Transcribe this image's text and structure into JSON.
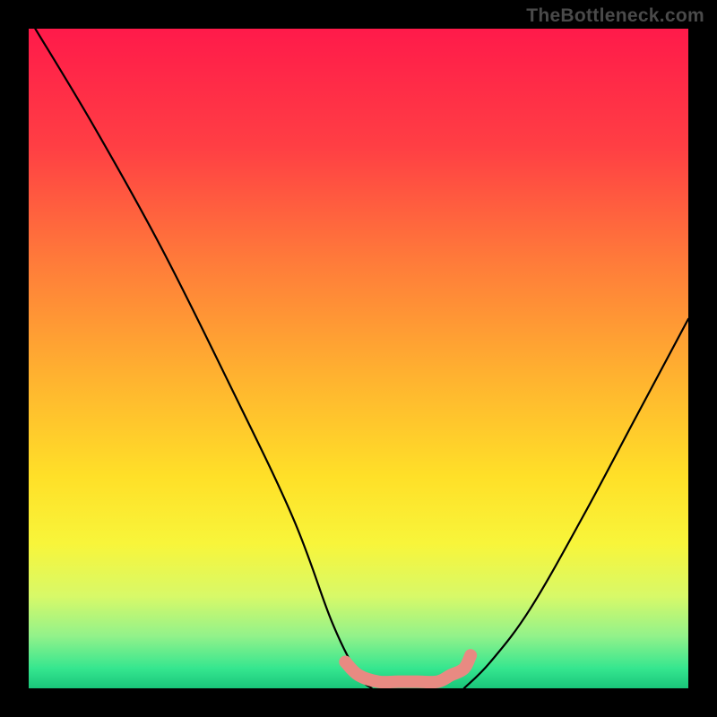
{
  "watermark": "TheBottleneck.com",
  "chart_data": {
    "type": "line",
    "title": "",
    "xlabel": "",
    "ylabel": "",
    "xlim": [
      0,
      100
    ],
    "ylim": [
      0,
      100
    ],
    "series": [
      {
        "name": "left-curve",
        "x": [
          1,
          10,
          20,
          30,
          40,
          46,
          50,
          52
        ],
        "y": [
          100,
          85,
          67,
          47,
          26,
          10,
          2,
          0
        ]
      },
      {
        "name": "right-curve",
        "x": [
          66,
          70,
          76,
          84,
          92,
          100
        ],
        "y": [
          0,
          4,
          12,
          26,
          41,
          56
        ]
      },
      {
        "name": "valley-pink",
        "x": [
          48,
          50,
          53,
          56,
          59,
          62,
          64,
          66,
          67
        ],
        "y": [
          4,
          2,
          1,
          1,
          1,
          1,
          2,
          3,
          5
        ]
      }
    ],
    "background_gradient": {
      "stops": [
        {
          "offset": 0.0,
          "color": "#ff1a4a"
        },
        {
          "offset": 0.18,
          "color": "#ff3f44"
        },
        {
          "offset": 0.35,
          "color": "#ff7a3a"
        },
        {
          "offset": 0.52,
          "color": "#ffb030"
        },
        {
          "offset": 0.68,
          "color": "#ffe028"
        },
        {
          "offset": 0.78,
          "color": "#f8f53a"
        },
        {
          "offset": 0.86,
          "color": "#d8f968"
        },
        {
          "offset": 0.92,
          "color": "#93f28a"
        },
        {
          "offset": 0.97,
          "color": "#35e68f"
        },
        {
          "offset": 1.0,
          "color": "#19c67a"
        }
      ]
    },
    "curve_color": "#000000",
    "valley_color": "#e88a82"
  }
}
